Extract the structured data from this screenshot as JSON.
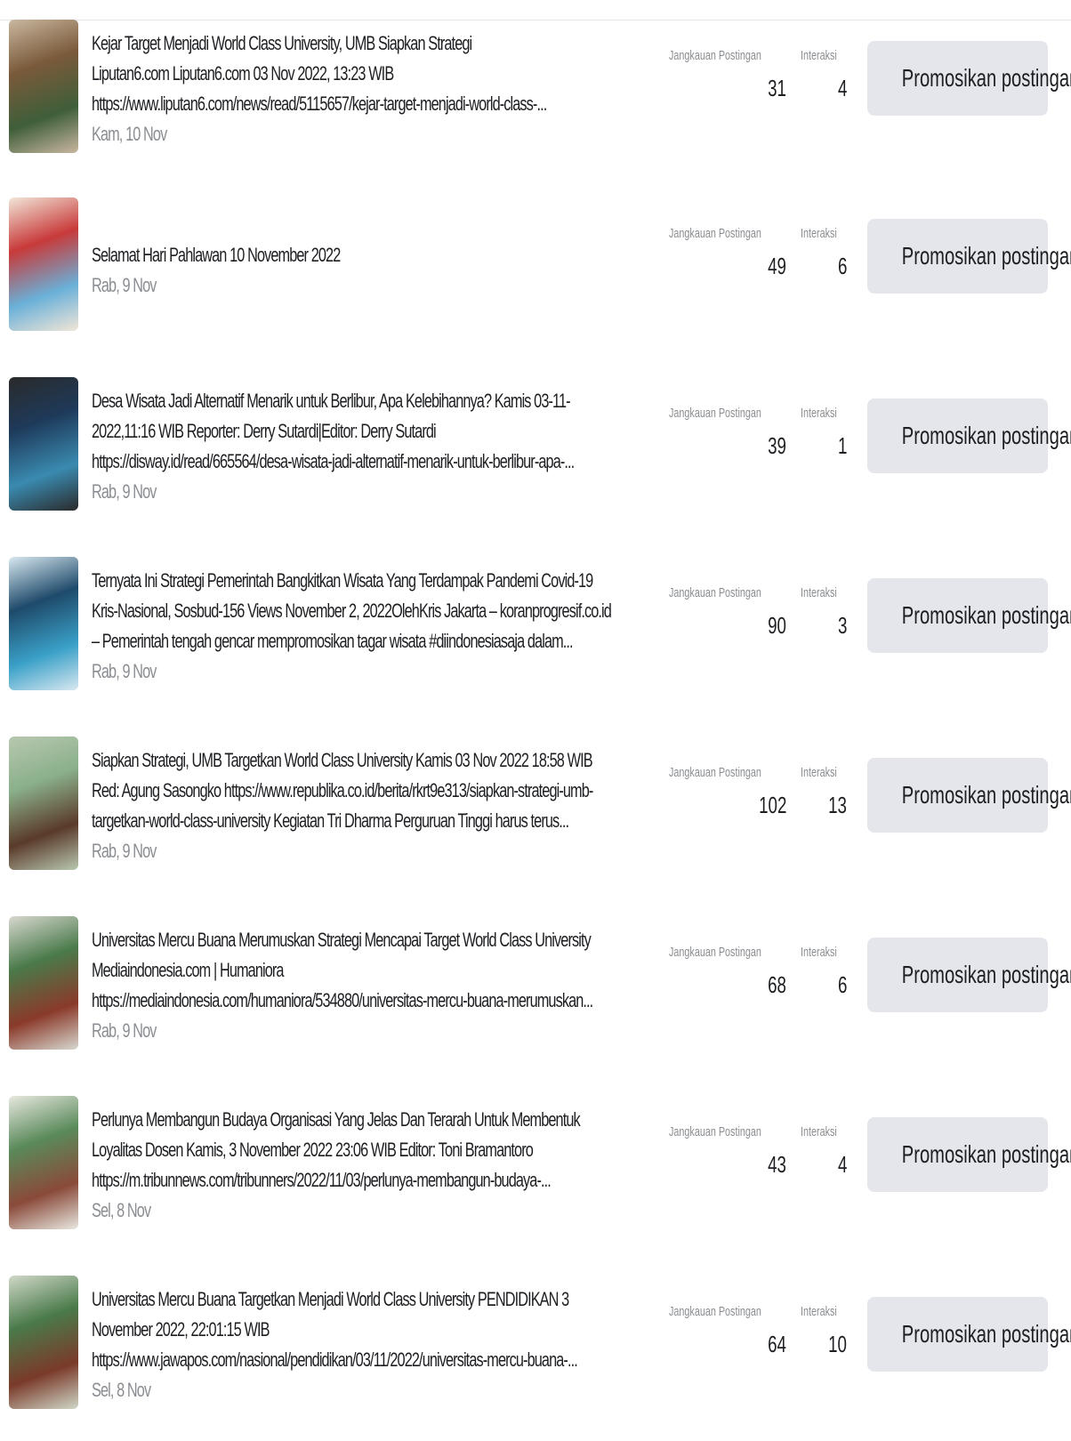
{
  "labels": {
    "reach": "Jangkauan Postingan",
    "interactions": "Interaksi",
    "promote": "Promosikan postingan"
  },
  "posts": [
    {
      "lines": [
        "Kejar Target Menjadi World Class University, UMB Siapkan Strategi",
        "Liputan6.com Liputan6.com 03 Nov 2022, 13:23 WIB",
        "https://www.liputan6.com/news/read/5115657/kejar-target-menjadi-world-class-..."
      ],
      "date": "Kam, 10 Nov",
      "reach": "31",
      "interactions": "4",
      "thumb_colors": [
        "#7a5a3a",
        "#3f5e3a",
        "#c9b7a0"
      ]
    },
    {
      "lines": [
        "Selamat Hari Pahlawan 10 November 2022"
      ],
      "date": "Rab, 9 Nov",
      "reach": "49",
      "interactions": "6",
      "thumb_colors": [
        "#c83a3a",
        "#6ab0d8",
        "#f2e6d8"
      ]
    },
    {
      "lines": [
        "Desa Wisata Jadi Alternatif Menarik untuk Berlibur, Apa Kelebihannya? Kamis 03-11-",
        "2022,11:16 WIB Reporter: Derry Sutardi|Editor: Derry Sutardi",
        "https://disway.id/read/665564/desa-wisata-jadi-alternatif-menarik-untuk-berlibur-apa-..."
      ],
      "date": "Rab, 9 Nov",
      "reach": "39",
      "interactions": "1",
      "thumb_colors": [
        "#1e3a5a",
        "#3a8ab0",
        "#2a2a2a"
      ]
    },
    {
      "lines": [
        "Ternyata Ini Strategi Pemerintah Bangkitkan Wisata Yang Terdampak Pandemi Covid-19",
        "Kris-Nasional, Sosbud-156 Views November 2, 2022OlehKris Jakarta – koranprogresif.co.id",
        "– Pemerintah tengah gencar mempromosikan tagar wisata #diindonesiasaja dalam..."
      ],
      "date": "Rab, 9 Nov",
      "reach": "90",
      "interactions": "3",
      "thumb_colors": [
        "#1e4a6a",
        "#3aa0c8",
        "#d8e8f0"
      ]
    },
    {
      "lines": [
        "Siapkan Strategi, UMB Targetkan World Class University Kamis 03 Nov 2022 18:58 WIB",
        "Red: Agung Sasongko https://www.republika.co.id/berita/rkrt9e313/siapkan-strategi-umb-",
        "targetkan-world-class-university Kegiatan Tri Dharma Perguruan Tinggi harus terus..."
      ],
      "date": "Rab, 9 Nov",
      "reach": "102",
      "interactions": "13",
      "thumb_colors": [
        "#8ab08a",
        "#5a3a2a",
        "#b8c8b0"
      ]
    },
    {
      "lines": [
        "Universitas Mercu Buana Merumuskan Strategi Mencapai Target World Class University",
        "Mediaindonesia.com | Humaniora",
        "https://mediaindonesia.com/humaniora/534880/universitas-mercu-buana-merumuskan..."
      ],
      "date": "Rab, 9 Nov",
      "reach": "68",
      "interactions": "6",
      "thumb_colors": [
        "#4a7a4a",
        "#8a3a2a",
        "#d8d8d0"
      ]
    },
    {
      "lines": [
        "Perlunya Membangun Budaya Organisasi Yang Jelas Dan Terarah Untuk Membentuk",
        "Loyalitas Dosen Kamis, 3 November 2022 23:06 WIB Editor: Toni Bramantoro",
        "https://m.tribunnews.com/tribunners/2022/11/03/perlunya-membangun-budaya-..."
      ],
      "date": "Sel, 8 Nov",
      "reach": "43",
      "interactions": "4",
      "thumb_colors": [
        "#5a8a5a",
        "#8a4a3a",
        "#e8e8e0"
      ]
    },
    {
      "lines": [
        "Universitas Mercu Buana Targetkan Menjadi World Class University PENDIDIKAN 3",
        "November 2022, 22:01:15 WIB",
        "https://www.jawapos.com/nasional/pendidikan/03/11/2022/universitas-mercu-buana-..."
      ],
      "date": "Sel, 8 Nov",
      "reach": "64",
      "interactions": "10",
      "thumb_colors": [
        "#4a7a4a",
        "#7a3a2a",
        "#d0d8c8"
      ]
    }
  ]
}
